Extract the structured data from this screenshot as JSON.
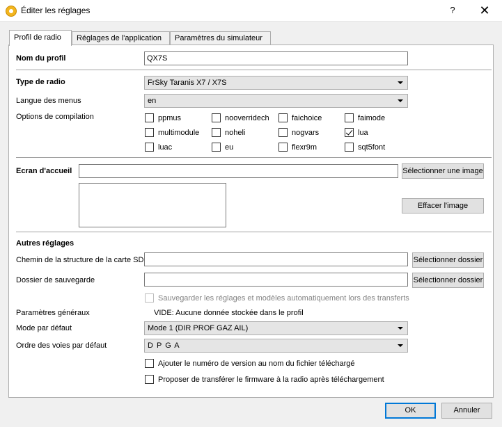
{
  "window": {
    "title": "Éditer les réglages",
    "help_label": "?",
    "close_label": "✕"
  },
  "tabs": [
    {
      "label": "Profil de radio"
    },
    {
      "label": "Réglages de l'application"
    },
    {
      "label": "Paramètres du simulateur"
    }
  ],
  "profile": {
    "name_label": "Nom du profil",
    "name_value": "QX7S",
    "radio_type_label": "Type de radio",
    "radio_type_value": "FrSky Taranis X7 / X7S",
    "menu_lang_label": "Langue des menus",
    "menu_lang_value": "en",
    "build_options_label": "Options de compilation",
    "options": [
      {
        "label": "ppmus",
        "checked": false
      },
      {
        "label": "nooverridech",
        "checked": false
      },
      {
        "label": "faichoice",
        "checked": false
      },
      {
        "label": "faimode",
        "checked": false
      },
      {
        "label": "multimodule",
        "checked": false
      },
      {
        "label": "noheli",
        "checked": false
      },
      {
        "label": "nogvars",
        "checked": false
      },
      {
        "label": "lua",
        "checked": true
      },
      {
        "label": "luac",
        "checked": false
      },
      {
        "label": "eu",
        "checked": false
      },
      {
        "label": "flexr9m",
        "checked": false
      },
      {
        "label": "sqt5font",
        "checked": false
      }
    ]
  },
  "splash": {
    "label": "Ecran d'accueil",
    "value": "",
    "select_image_label": "Sélectionner une image",
    "clear_image_label": "Effacer l'image"
  },
  "other": {
    "heading": "Autres réglages",
    "sd_path_label": "Chemin de la structure de la carte SD",
    "sd_path_value": "",
    "backup_label": "Dossier de sauvegarde",
    "backup_value": "",
    "select_folder_label": "Sélectionner dossier",
    "auto_backup_label": "Sauvegarder les réglages et modèles automatiquement lors des transferts",
    "general_params_label": "Paramètres généraux",
    "general_params_value": "VIDE: Aucune donnée stockée dans le profil",
    "default_mode_label": "Mode par défaut",
    "default_mode_value": "Mode 1 (DIR PROF GAZ AIL)",
    "channel_order_label": "Ordre des voies par défaut",
    "channel_order_value": "D P G A",
    "append_version_label": "Ajouter le numéro de version au nom du fichier téléchargé",
    "offer_flash_label": "Proposer de transférer le firmware à la radio après téléchargement"
  },
  "footer": {
    "ok_label": "OK",
    "cancel_label": "Annuler"
  }
}
